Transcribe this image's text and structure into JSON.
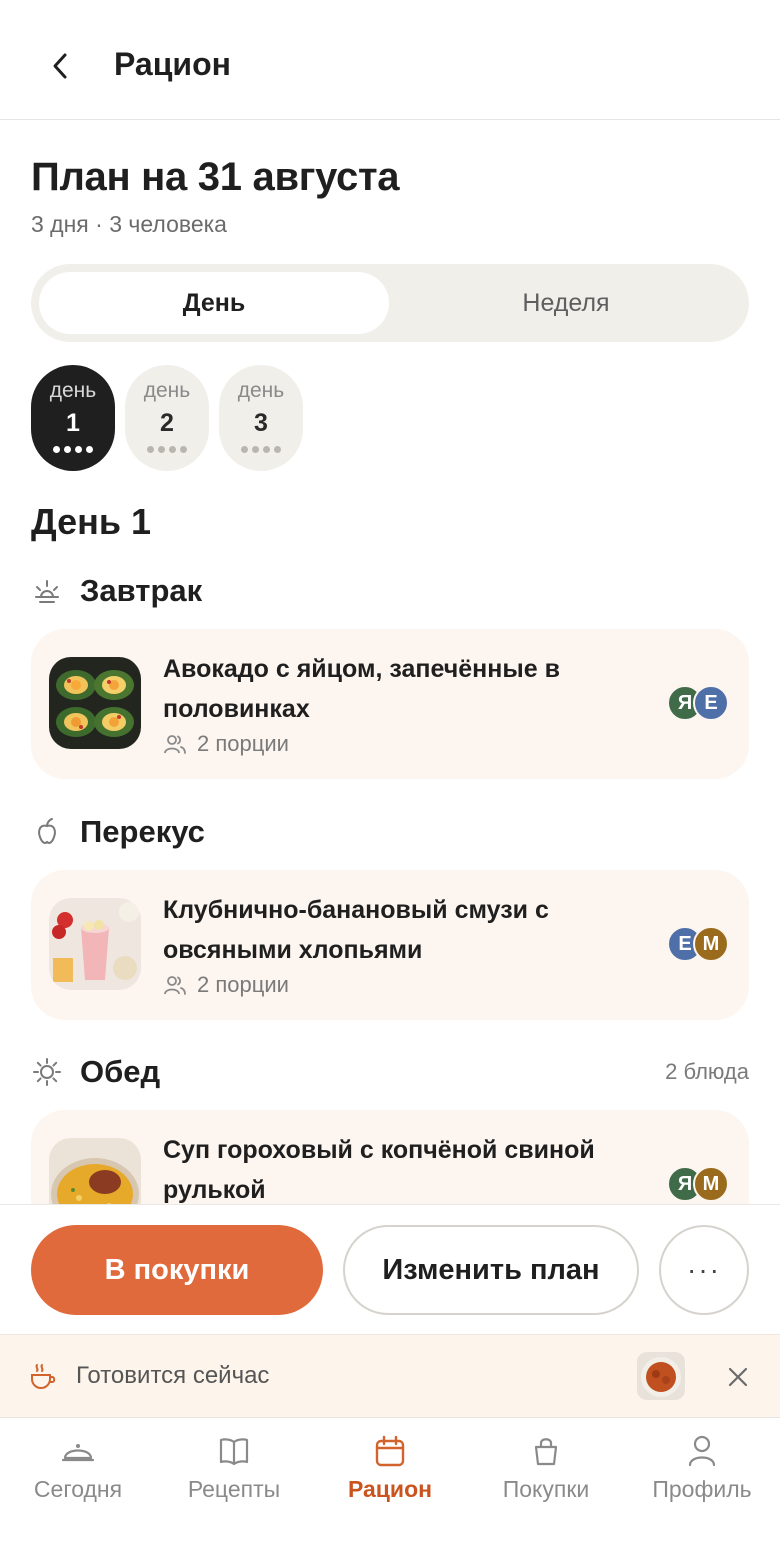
{
  "header": {
    "title": "Рацион",
    "back_icon": "chevron-left-icon"
  },
  "plan": {
    "title": "План на 31 августа",
    "subtitle": "3 дня · 3 человека"
  },
  "segment": {
    "tabs": [
      {
        "label": "День",
        "active": true
      },
      {
        "label": "Неделя",
        "active": false
      }
    ]
  },
  "days": [
    {
      "label": "день",
      "number": "1",
      "active": true
    },
    {
      "label": "день",
      "number": "2",
      "active": false
    },
    {
      "label": "день",
      "number": "3",
      "active": false
    }
  ],
  "day_heading": "День 1",
  "meals": [
    {
      "name": "Завтрак",
      "icon": "sunrise-icon",
      "count": "",
      "dish": {
        "title": "Авокадо с яйцом, запечённые в половинках",
        "portions": "2 порции",
        "avatars": [
          "Я",
          "Е"
        ]
      }
    },
    {
      "name": "Перекус",
      "icon": "apple-icon",
      "count": "",
      "dish": {
        "title": "Клубнично-банановый смузи с овсяными хлопьями",
        "portions": "2 порции",
        "avatars": [
          "Е",
          "М"
        ]
      }
    },
    {
      "name": "Обед",
      "icon": "sun-icon",
      "count": "2 блюда",
      "dish": {
        "title": "Суп гороховый с копчёной свиной рулькой",
        "portions": "",
        "avatars": [
          "Я",
          "М"
        ]
      }
    }
  ],
  "avatar_colors": {
    "Я": "#3f6b48",
    "Е": "#4f6fa8",
    "М": "#9a6b1c"
  },
  "actions": {
    "primary": "В покупки",
    "secondary": "Изменить план",
    "more": "···"
  },
  "cooking_now": {
    "label": "Готовится сейчас"
  },
  "tabbar": [
    {
      "label": "Сегодня",
      "icon": "cloche-icon",
      "active": false
    },
    {
      "label": "Рецепты",
      "icon": "book-icon",
      "active": false
    },
    {
      "label": "Рацион",
      "icon": "calendar-icon",
      "active": true
    },
    {
      "label": "Покупки",
      "icon": "bag-icon",
      "active": false
    },
    {
      "label": "Профиль",
      "icon": "person-icon",
      "active": false
    }
  ],
  "colors": {
    "accent": "#e06a3b",
    "accent_text": "#c9541f",
    "card_bg": "#fdf5ef",
    "chip_active": "#1f1f1f"
  }
}
